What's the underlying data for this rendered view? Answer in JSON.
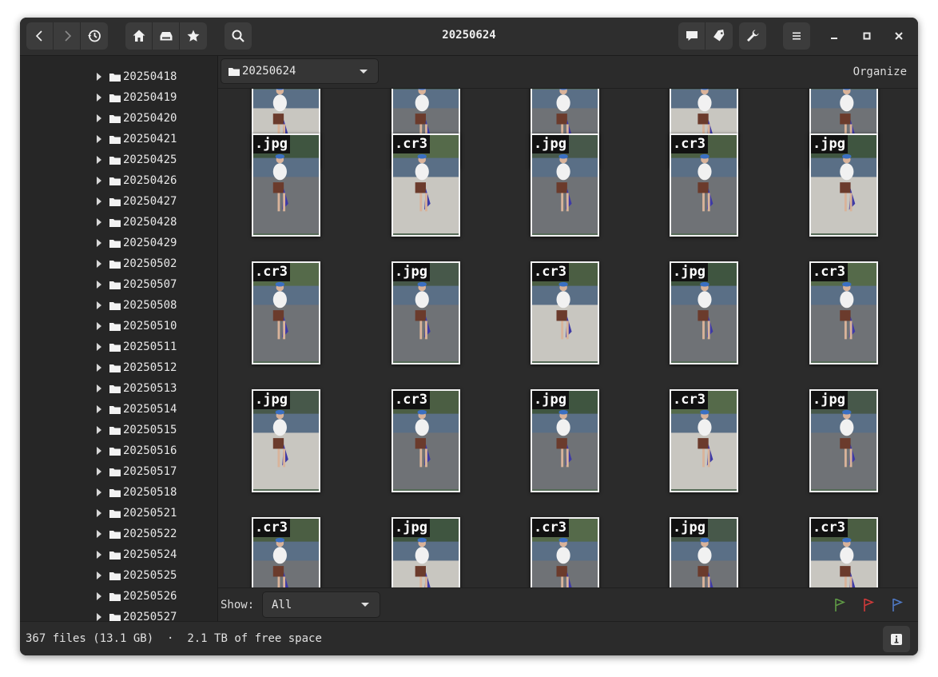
{
  "window": {
    "title": "20250624"
  },
  "header": {
    "back_icon": "chevron-left-icon",
    "forward_icon": "chevron-right-icon",
    "history_icon": "history-icon",
    "home_icon": "home-icon",
    "drive_icon": "drive-icon",
    "bookmarks_icon": "star-icon",
    "search_icon": "search-icon",
    "comment_icon": "comment-icon",
    "tag_icon": "tag-icon",
    "tools_icon": "wrench-icon",
    "menu_icon": "hamburger-menu-icon"
  },
  "sidebar": {
    "items": [
      "20250418",
      "20250419",
      "20250420",
      "20250421",
      "20250425",
      "20250426",
      "20250427",
      "20250428",
      "20250429",
      "20250502",
      "20250507",
      "20250508",
      "20250510",
      "20250511",
      "20250512",
      "20250513",
      "20250514",
      "20250515",
      "20250516",
      "20250517",
      "20250518",
      "20250521",
      "20250522",
      "20250524",
      "20250525",
      "20250526",
      "20250527"
    ]
  },
  "location": {
    "current": "20250624",
    "organize_label": "Organize"
  },
  "grid": {
    "rows": [
      [
        "",
        "",
        "",
        "",
        ""
      ],
      [
        ".jpg",
        ".cr3",
        ".jpg",
        ".cr3",
        ".jpg"
      ],
      [
        ".cr3",
        ".jpg",
        ".cr3",
        ".jpg",
        ".cr3"
      ],
      [
        ".jpg",
        ".cr3",
        ".jpg",
        ".cr3",
        ".jpg"
      ],
      [
        ".cr3",
        ".jpg",
        ".cr3",
        ".jpg",
        ".cr3"
      ]
    ]
  },
  "filter": {
    "label": "Show:",
    "value": "All"
  },
  "flags": {
    "green": "#5f9a45",
    "red": "#cf3a3a",
    "blue": "#4f79c4"
  },
  "status": {
    "files": "367 files (13.1 GB)",
    "separator": "·",
    "free_space": "2.1 TB of free space"
  }
}
